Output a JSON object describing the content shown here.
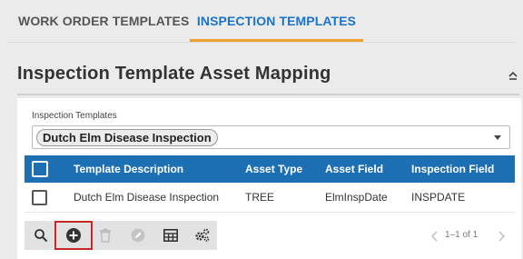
{
  "tabs": {
    "work_order": "WORK ORDER TEMPLATES",
    "inspection": "INSPECTION TEMPLATES",
    "active": "inspection",
    "accent_color": "#f0a030",
    "active_color": "#1a73c8"
  },
  "section": {
    "title": "Inspection Template Asset Mapping"
  },
  "filter": {
    "label": "Inspection Templates",
    "selected": "Dutch Elm Disease Inspection"
  },
  "table": {
    "header_color": "#1d6fb4",
    "columns": [
      "Template Description",
      "Asset Type",
      "Asset Field",
      "Inspection Field"
    ],
    "rows": [
      {
        "description": "Dutch Elm Disease Inspection",
        "asset_type": "TREE",
        "asset_field": "ElmInspDate",
        "inspection_field": "INSPDATE",
        "checked": false
      }
    ]
  },
  "toolbar": {
    "buttons": [
      "search-icon",
      "add-icon",
      "delete-icon",
      "edit-icon",
      "columns-icon",
      "settings-icon"
    ]
  },
  "pager": {
    "text": "1–1 of 1"
  }
}
